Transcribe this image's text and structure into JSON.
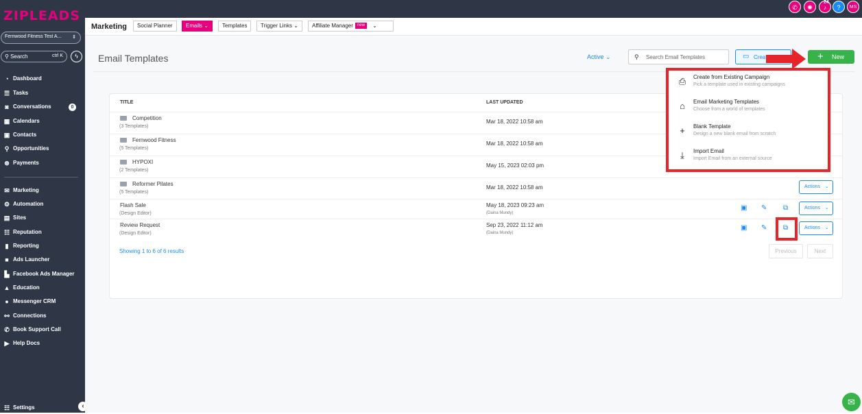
{
  "app": {
    "logo": "ZIPLEADS",
    "account": "Fernwood Fitness Test A...",
    "search_label": "Search",
    "search_shortcut": "ctrl K"
  },
  "sidebar": {
    "items": [
      {
        "label": "Dashboard",
        "icon": "dashboard-icon",
        "glyph": "◔"
      },
      {
        "label": "Tasks",
        "icon": "tasks-icon",
        "glyph": "☰"
      },
      {
        "label": "Conversations",
        "icon": "conversations-icon",
        "glyph": "◙",
        "badge": "0"
      },
      {
        "label": "Calendars",
        "icon": "calendar-icon",
        "glyph": "▦"
      },
      {
        "label": "Contacts",
        "icon": "contacts-icon",
        "glyph": "▣"
      },
      {
        "label": "Opportunities",
        "icon": "opportunities-icon",
        "glyph": "⚲"
      },
      {
        "label": "Payments",
        "icon": "payments-icon",
        "glyph": "⊛"
      },
      {
        "label": "Marketing",
        "icon": "marketing-icon",
        "glyph": "✉"
      },
      {
        "label": "Automation",
        "icon": "automation-icon",
        "glyph": "⚙"
      },
      {
        "label": "Sites",
        "icon": "sites-icon",
        "glyph": "▤"
      },
      {
        "label": "Reputation",
        "icon": "reputation-icon",
        "glyph": "☷"
      },
      {
        "label": "Reporting",
        "icon": "reporting-icon",
        "glyph": "▮"
      },
      {
        "label": "Ads Launcher",
        "icon": "ads-launcher-icon",
        "glyph": "■"
      },
      {
        "label": "Facebook Ads Manager",
        "icon": "facebook-ads-icon",
        "glyph": "▙"
      },
      {
        "label": "Education",
        "icon": "education-icon",
        "glyph": "▲"
      },
      {
        "label": "Messenger CRM",
        "icon": "messenger-icon",
        "glyph": "●"
      },
      {
        "label": "Connections",
        "icon": "connections-icon",
        "glyph": "⚯"
      },
      {
        "label": "Book Support Call",
        "icon": "support-call-icon",
        "glyph": "✆"
      },
      {
        "label": "Help Docs",
        "icon": "help-docs-icon",
        "glyph": "▶"
      }
    ],
    "settings": "Settings"
  },
  "topbar": {
    "notification_count": "24",
    "avatar_initials": "MS",
    "help": "?"
  },
  "subnav": {
    "title": "Marketing",
    "tabs": [
      {
        "label": "Social Planner"
      },
      {
        "label": "Emails",
        "active": true
      },
      {
        "label": "Templates"
      },
      {
        "label": "Trigger Links"
      },
      {
        "label": "Affiliate Manager",
        "tag": "new"
      }
    ]
  },
  "page": {
    "title": "Email Templates",
    "filter": "Active",
    "search_placeholder": "Search Email Templates",
    "create_label": "Creat",
    "new_label": "New"
  },
  "table": {
    "headers": {
      "title": "TITLE",
      "updated": "LAST UPDATED"
    },
    "rows": [
      {
        "name": "Competition",
        "sub": "(3 Templates)",
        "date": "Mar 18, 2022 10:58 am",
        "folder": true
      },
      {
        "name": "Fernwood Fitness",
        "sub": "(5 Templates)",
        "date": "Mar 18, 2022 10:58 am",
        "folder": true
      },
      {
        "name": "HYPOXI",
        "sub": "(2 Templates)",
        "date": "May 15, 2023 02:03 pm",
        "folder": true
      },
      {
        "name": "Reformer Pilates",
        "sub": "(5 Templates)",
        "date": "Mar 18, 2022 10:58 am",
        "folder": true,
        "actions": "Actions"
      },
      {
        "name": "Flash Sale",
        "sub": "(Design Editor)",
        "date": "May 18, 2023 09:23 am",
        "user": "(Daina Mundy)",
        "actions": "Actions"
      },
      {
        "name": "Review Request",
        "sub": "(Design Editor)",
        "date": "Sep 23, 2022 11:12 am",
        "user": "(Daina Mundy)",
        "actions": "Actions"
      }
    ],
    "showing": "Showing 1 to 6 of 6 results",
    "prev": "Previous",
    "next": "Next"
  },
  "dropdown": [
    {
      "title": "Create from Existing Campaign",
      "desc": "Pick a template used in existing campaigns",
      "icon": "campaign-icon",
      "glyph": "⎙"
    },
    {
      "title": "Email Marketing Templates",
      "desc": "Choose from a world of templates",
      "icon": "templates-icon",
      "glyph": "⌂"
    },
    {
      "title": "Blank Template",
      "desc": "Design a new blank email from scratch",
      "icon": "plus-icon",
      "glyph": "+"
    },
    {
      "title": "Import Email",
      "desc": "Import Email from an external source",
      "icon": "import-icon",
      "glyph": "⤓"
    }
  ],
  "colors": {
    "sidebar": "#2f3747",
    "brand": "#e6007e",
    "accent": "#188bf6",
    "green": "#37b34a",
    "highlight": "#e8242b"
  }
}
